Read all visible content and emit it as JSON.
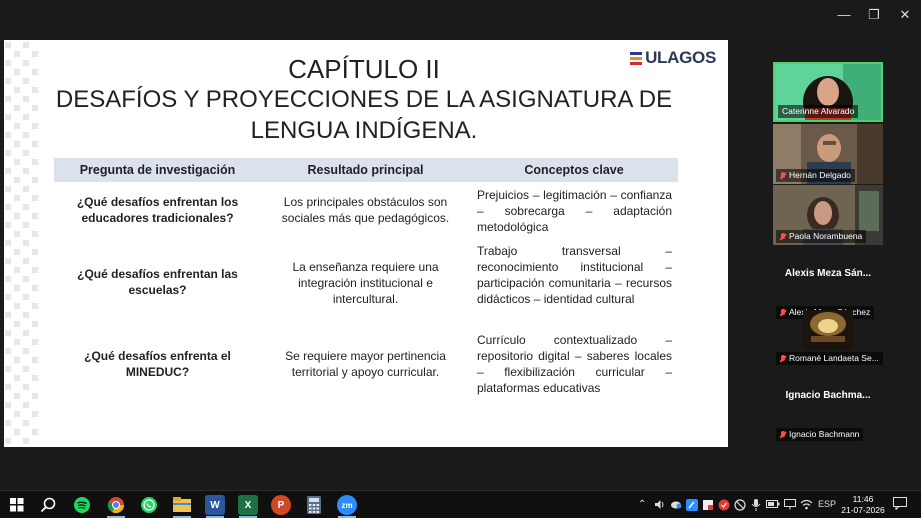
{
  "window": {
    "minimize_glyph": "—",
    "maximize_glyph": "❐",
    "close_glyph": "✕"
  },
  "slide": {
    "logo_text": "ULAGOS",
    "logo_colors": [
      "#2b3a8f",
      "#f08a1c",
      "#d32f2f"
    ],
    "title_line1": "CAPÍTULO II",
    "title_line2": "DESAFÍOS Y PROYECCIONES DE LA ASIGNATURA DE",
    "title_line3": "LENGUA INDÍGENA.",
    "table": {
      "headers": [
        "Pregunta de investigación",
        "Resultado principal",
        "Conceptos clave"
      ],
      "rows": [
        {
          "question": "¿Qué desafíos enfrentan los educadores tradicionales?",
          "result": "Los principales obstáculos son sociales más que pedagógicos.",
          "concepts": "Prejuicios – legitimación – confianza – sobrecarga – adaptación metodológica"
        },
        {
          "question": "¿Qué desafíos enfrentan las escuelas?",
          "result": "La enseñanza requiere una integración institucional e intercultural.",
          "concepts": "Trabajo transversal – reconocimiento institucional – participación comunitaria – recursos didácticos – identidad cultural"
        },
        {
          "question": "¿Qué desafíos enfrenta el MINEDUC?",
          "result": "Se requiere mayor pertinencia territorial y apoyo curricular.",
          "concepts": "Currículo contextualizado – repositorio digital – saberes locales – flexibilización curricular – plataformas educativas"
        }
      ]
    }
  },
  "participants": [
    {
      "name": "Caterinne Alvarado",
      "active": true,
      "muted": false
    },
    {
      "name": "Hernán Delgado",
      "muted": true
    },
    {
      "name": "Paola Norambuena",
      "muted": true
    },
    {
      "big_name": "Alexis  Meza  Sán...",
      "name": "Alexis Meza Sánchez",
      "muted": true
    },
    {
      "name": "Romané Landaeta Se...",
      "muted": true
    },
    {
      "big_name": "Ignacio  Bachma...",
      "name": "Ignacio Bachmann",
      "muted": true
    }
  ],
  "taskbar": {
    "apps": [
      "windows-start",
      "search",
      "spotify",
      "chrome",
      "whatsapp",
      "file-explorer",
      "word",
      "excel",
      "powerpoint",
      "calculator",
      "zoom"
    ],
    "word_letter": "W",
    "excel_letter": "X",
    "ppt_letter": "P",
    "zoom_letter": "zm",
    "language": "ESP",
    "time": "11:46",
    "date": "21-07-2026",
    "accent": "#8fb8e8"
  }
}
